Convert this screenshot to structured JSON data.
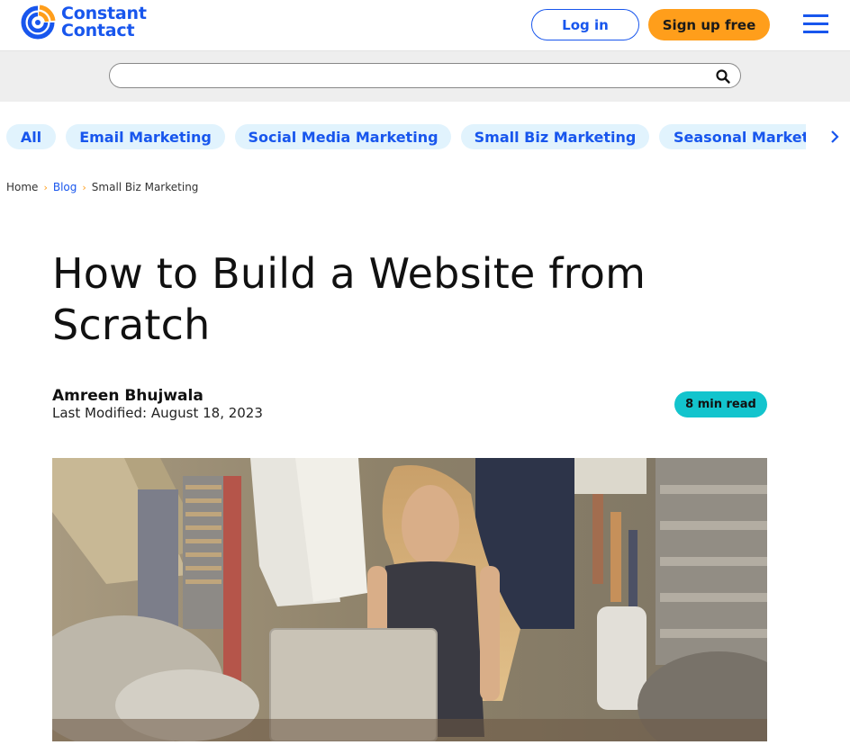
{
  "header": {
    "brand": {
      "line1": "Constant",
      "line2": "Contact",
      "colors": {
        "blue": "#1856ed",
        "orange": "#ff9e1b"
      }
    },
    "login_label": "Log in",
    "signup_label": "Sign up free",
    "menu_icon": "hamburger-menu-icon"
  },
  "search": {
    "value": "",
    "placeholder": "",
    "icon": "search-icon"
  },
  "categories": {
    "items": [
      {
        "label": "All"
      },
      {
        "label": "Email Marketing"
      },
      {
        "label": "Social Media Marketing"
      },
      {
        "label": "Small Biz Marketing"
      },
      {
        "label": "Seasonal Marketing"
      }
    ],
    "next_icon": "chevron-right-icon"
  },
  "breadcrumb": {
    "items": [
      {
        "label": "Home"
      },
      {
        "label": "Blog"
      },
      {
        "label": "Small Biz Marketing"
      }
    ],
    "separator": "›"
  },
  "article": {
    "title": "How to Build a Website from Scratch",
    "author": "Amreen Bhujwala",
    "last_modified": "Last Modified: August 18, 2023",
    "read_time": "8 min read",
    "hero_image_alt": "Woman working on a laptop in a clothing shop"
  },
  "colors": {
    "accent_blue": "#1856ed",
    "accent_orange": "#ff9e1b",
    "pill_bg": "#e1f3fd",
    "badge_teal": "#13c4cd"
  }
}
